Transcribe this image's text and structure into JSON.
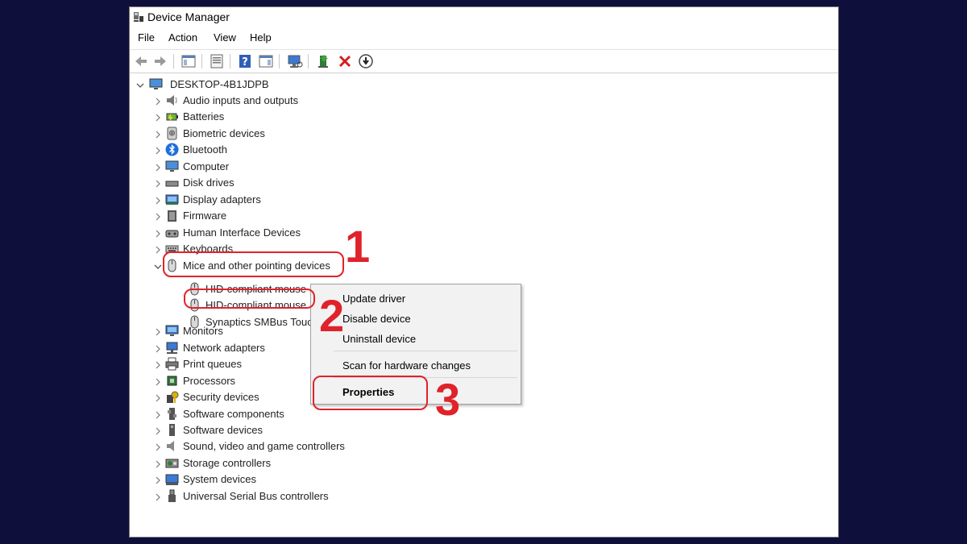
{
  "window": {
    "title": "Device Manager"
  },
  "menu": [
    "File",
    "Action",
    "View",
    "Help"
  ],
  "tree": {
    "root": "DESKTOP-4B1JDPB",
    "categories": [
      {
        "label": "Audio inputs and outputs",
        "icon": "speaker-icon"
      },
      {
        "label": "Batteries",
        "icon": "battery-icon"
      },
      {
        "label": "Biometric devices",
        "icon": "fingerprint-icon"
      },
      {
        "label": "Bluetooth",
        "icon": "bluetooth-icon"
      },
      {
        "label": "Computer",
        "icon": "computer-icon"
      },
      {
        "label": "Disk drives",
        "icon": "disk-icon"
      },
      {
        "label": "Display adapters",
        "icon": "display-adapter-icon"
      },
      {
        "label": "Firmware",
        "icon": "firmware-icon"
      },
      {
        "label": "Human Interface Devices",
        "icon": "hid-icon"
      },
      {
        "label": "Keyboards",
        "icon": "keyboard-icon"
      },
      {
        "label": "Mice and other pointing devices",
        "icon": "mouse-icon"
      },
      {
        "label": "Monitors",
        "icon": "monitor-icon"
      },
      {
        "label": "Network adapters",
        "icon": "network-icon"
      },
      {
        "label": "Print queues",
        "icon": "printer-icon"
      },
      {
        "label": "Processors",
        "icon": "cpu-icon"
      },
      {
        "label": "Security devices",
        "icon": "security-icon"
      },
      {
        "label": "Software components",
        "icon": "software-component-icon"
      },
      {
        "label": "Software devices",
        "icon": "software-device-icon"
      },
      {
        "label": "Sound, video and game controllers",
        "icon": "sound-icon"
      },
      {
        "label": "Storage controllers",
        "icon": "storage-icon"
      },
      {
        "label": "System devices",
        "icon": "system-icon"
      },
      {
        "label": "Universal Serial Bus controllers",
        "icon": "usb-icon"
      }
    ],
    "mice_children": [
      "HID-compliant mouse",
      "HID-compliant mouse",
      "Synaptics SMBus Touc"
    ]
  },
  "context_menu": {
    "items": [
      "Update driver",
      "Disable device",
      "Uninstall device",
      "Scan for hardware changes",
      "Properties"
    ]
  },
  "annotations": [
    "1",
    "2",
    "3"
  ],
  "colors": {
    "background": "#0f0f3c",
    "annotation": "#e0222a",
    "selection": "#cce8ff"
  }
}
